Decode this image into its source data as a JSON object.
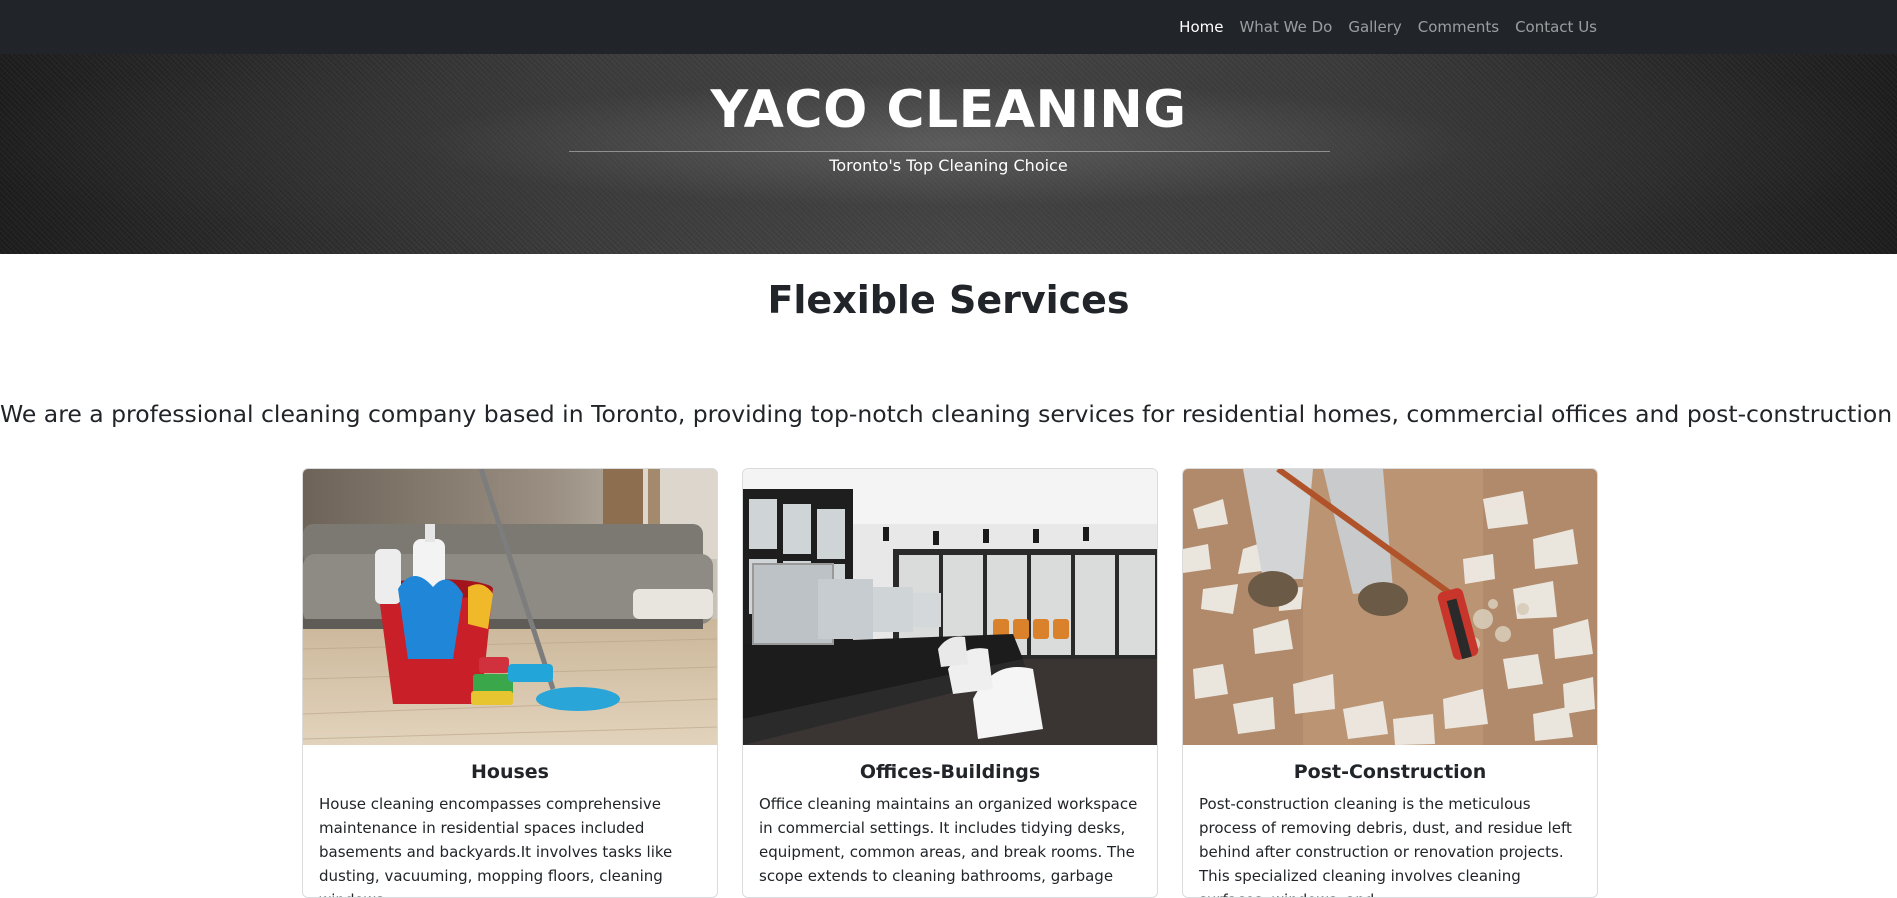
{
  "nav": {
    "items": [
      {
        "label": "Home",
        "active": true
      },
      {
        "label": "What We Do",
        "active": false
      },
      {
        "label": "Gallery",
        "active": false
      },
      {
        "label": "Comments",
        "active": false
      },
      {
        "label": "Contact Us",
        "active": false
      }
    ]
  },
  "hero": {
    "title": "YACO CLEANING",
    "subtitle": "Toronto's Top Cleaning Choice"
  },
  "services": {
    "title": "Flexible Services",
    "intro": "We are a professional cleaning company based in Toronto, providing top-notch cleaning services for residential homes, commercial offices and post-construction sites",
    "cards": [
      {
        "title": "Houses",
        "text": "House cleaning encompasses comprehensive maintenance in residential spaces included basements and backyards.It involves tasks like dusting, vacuuming, mopping floors, cleaning windows,"
      },
      {
        "title": "Offices-Buildings",
        "text": "Office cleaning maintains an organized workspace in commercial settings. It includes tidying desks, equipment, common areas, and break rooms. The scope extends to cleaning bathrooms, garbage"
      },
      {
        "title": "Post-Construction",
        "text": "Post-construction cleaning is the meticulous process of removing debris, dust, and residue left behind after construction or renovation projects. This specialized cleaning involves cleaning surfaces, windows, and"
      }
    ]
  }
}
